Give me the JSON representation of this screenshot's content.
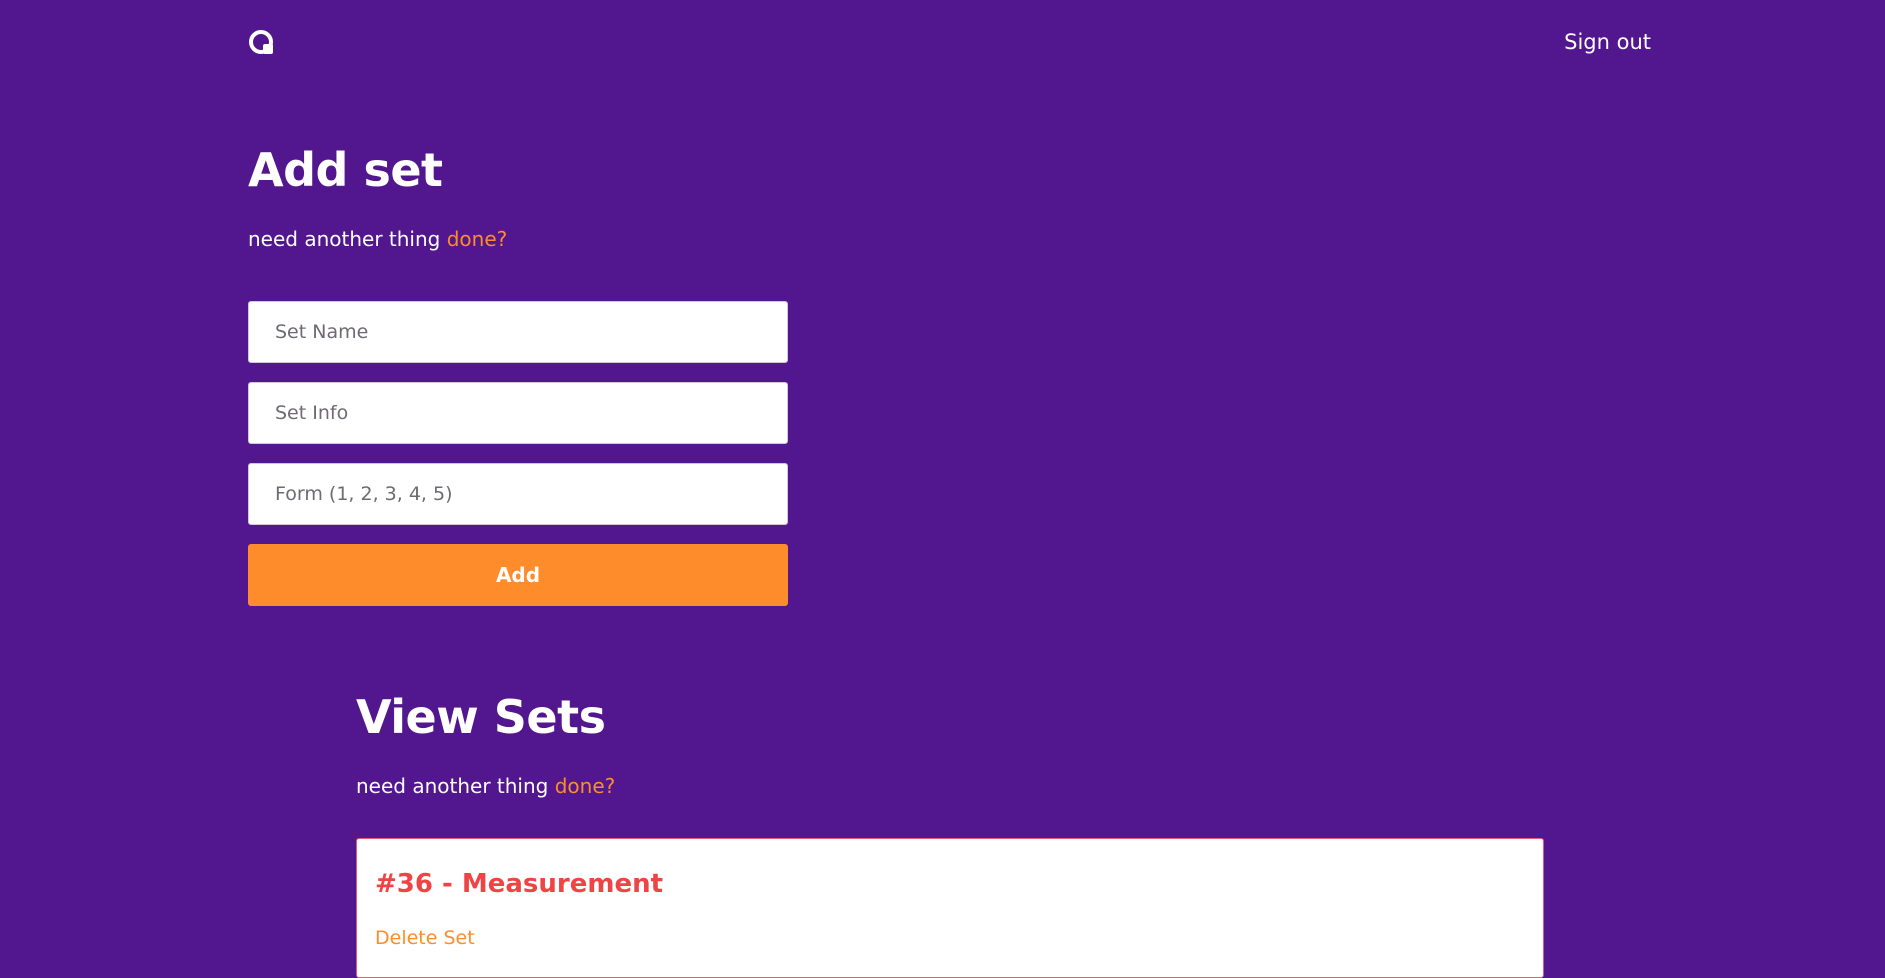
{
  "header": {
    "logo": "logo-icon",
    "signout_label": "Sign out"
  },
  "add_set": {
    "title": "Add set",
    "subtitle_prefix": "need another thing ",
    "subtitle_link": "done?",
    "fields": {
      "set_name_placeholder": "Set Name",
      "set_info_placeholder": "Set Info",
      "form_placeholder": "Form (1, 2, 3, 4, 5)"
    },
    "add_label": "Add"
  },
  "view_sets": {
    "title": "View Sets",
    "subtitle_prefix": "need another thing ",
    "subtitle_link": "done?",
    "sets": [
      {
        "title": "#36 - Measurement",
        "delete_label": "Delete Set"
      }
    ]
  },
  "colors": {
    "background": "#52168f",
    "accent": "#ff8c2a",
    "card_title": "#ef4444"
  }
}
